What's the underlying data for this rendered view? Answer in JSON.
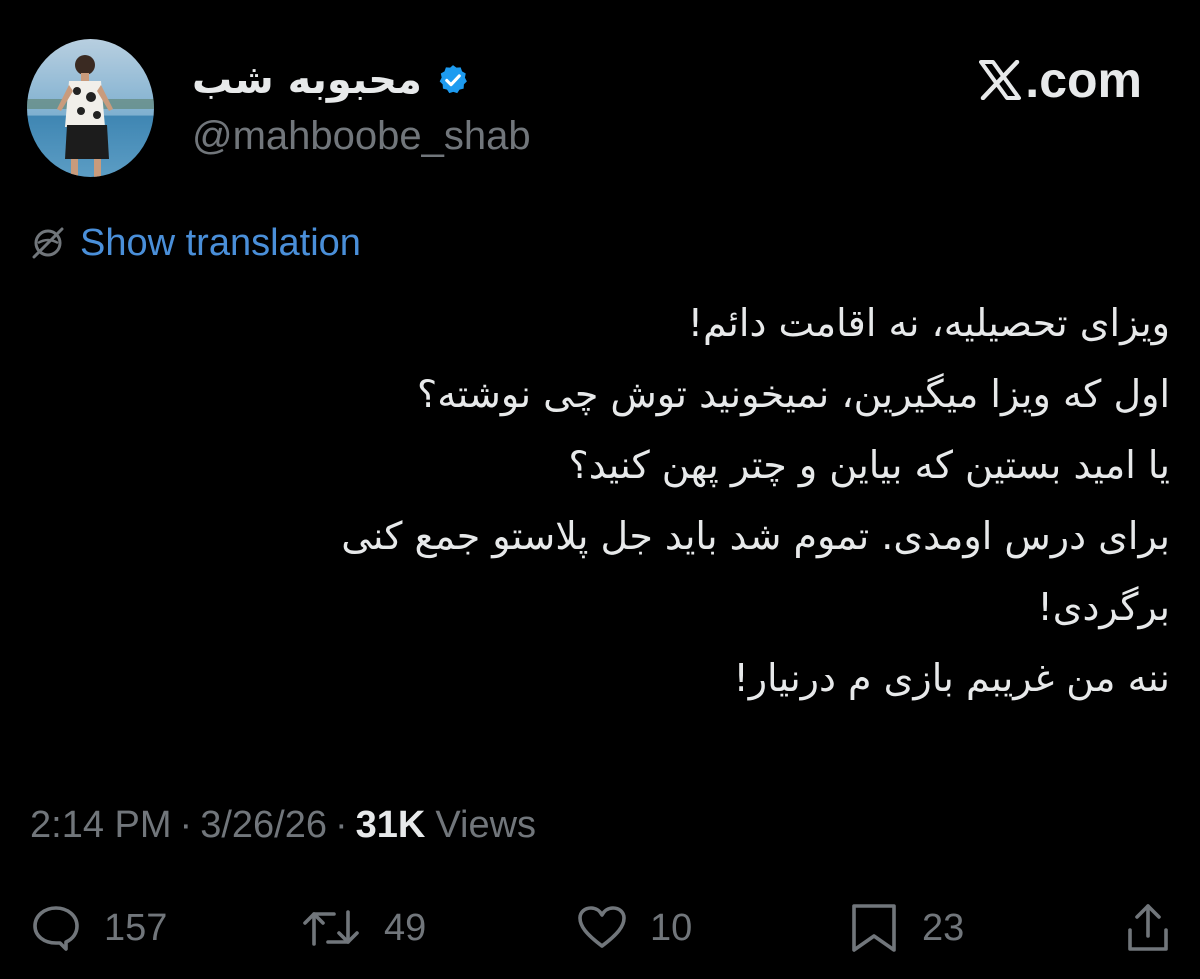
{
  "author": {
    "display_name": "محبوبه شب",
    "handle": "@mahboobe_shab",
    "avatar_icon": "profile-photo",
    "verified_icon": "verified-badge-icon"
  },
  "site": {
    "logo_icon": "x-logo-icon",
    "domain_text": ".com"
  },
  "translation": {
    "icon": "globe-slash-icon",
    "label": "Show translation"
  },
  "tweet": {
    "lines": [
      "ویزای تحصیلیه، نه اقامت دائم!",
      "اول که ویزا میگیرین، نمیخونید توش چی نوشته؟",
      "یا امید بستین که بیاین و چتر پهن کنید؟",
      "برای درس اومدی. تموم شد باید جل پلاستو جمع کنی",
      "برگردی!",
      "ننه من غریبم بازی م درنیار!"
    ]
  },
  "meta": {
    "time": "2:14 PM",
    "separator": "·",
    "date": "3/26/26",
    "views_count": "31K",
    "views_label": "Views"
  },
  "actions": {
    "reply": {
      "icon": "reply-icon",
      "count": "157"
    },
    "repost": {
      "icon": "repost-icon",
      "count": "49"
    },
    "like": {
      "icon": "heart-icon",
      "count": "10"
    },
    "bookmark": {
      "icon": "bookmark-icon",
      "count": "23"
    },
    "share": {
      "icon": "share-icon"
    }
  },
  "colors": {
    "background": "#000000",
    "primary_text": "#e7e9ea",
    "secondary_text": "#71767b",
    "link": "#4a8fd9",
    "verified": "#1d9bf0"
  }
}
